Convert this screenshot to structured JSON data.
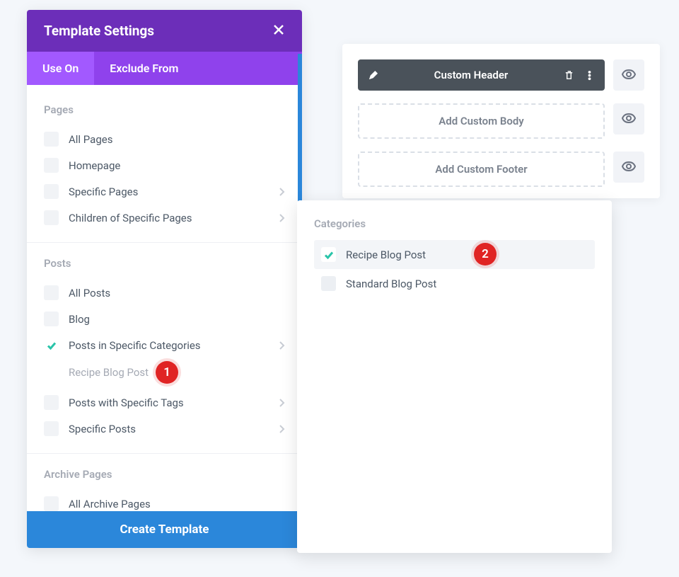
{
  "panel": {
    "title": "Template Settings",
    "tabs": {
      "use_on": "Use On",
      "exclude_from": "Exclude From"
    },
    "sections": {
      "pages": {
        "title": "Pages",
        "items": {
          "all_pages": "All Pages",
          "homepage": "Homepage",
          "specific_pages": "Specific Pages",
          "children_specific": "Children of Specific Pages"
        }
      },
      "posts": {
        "title": "Posts",
        "items": {
          "all_posts": "All Posts",
          "blog": "Blog",
          "posts_in_categories": "Posts in Specific Categories",
          "posts_with_tags": "Posts with Specific Tags",
          "specific_posts": "Specific Posts"
        },
        "subitem": "Recipe Blog Post"
      },
      "archive": {
        "title": "Archive Pages",
        "items": {
          "all_archive": "All Archive Pages"
        }
      }
    },
    "create_button": "Create Template"
  },
  "right": {
    "custom_header": "Custom Header",
    "add_custom_body": "Add Custom Body",
    "add_custom_footer": "Add Custom Footer"
  },
  "popover": {
    "title": "Categories",
    "items": {
      "recipe": "Recipe Blog Post",
      "standard": "Standard Blog Post"
    }
  },
  "badges": {
    "one": "1",
    "two": "2"
  }
}
